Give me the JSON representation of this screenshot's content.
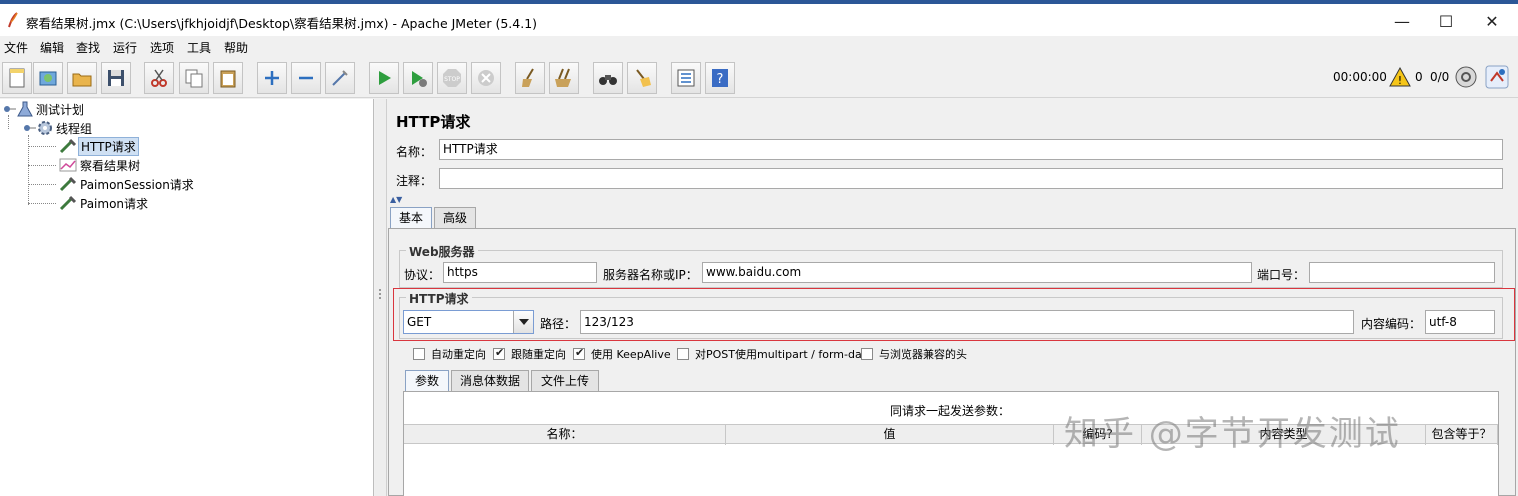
{
  "window": {
    "title": "察看结果树.jmx (C:\\Users\\jfkhjoidjf\\Desktop\\察看结果树.jmx) - Apache JMeter (5.4.1)",
    "minimize": "—",
    "maximize": "☐",
    "close": "✕"
  },
  "menu": [
    "文件",
    "编辑",
    "查找",
    "运行",
    "选项",
    "工具",
    "帮助"
  ],
  "toolbar": {
    "timer": "00:00:00",
    "warning_count": "0",
    "thread_ratio": "0/0"
  },
  "tree": {
    "test_plan": "测试计划",
    "thread_group": "线程组",
    "items": [
      "HTTP请求",
      "察看结果树",
      "PaimonSession请求",
      "Paimon请求"
    ]
  },
  "panel": {
    "title": "HTTP请求",
    "name_label": "名称：",
    "name_value": "HTTP请求",
    "comment_label": "注释：",
    "comment_value": "",
    "tabs": [
      "基本",
      "高级"
    ],
    "web_server": {
      "title": "Web服务器",
      "protocol_label": "协议：",
      "protocol_value": "https",
      "server_label": "服务器名称或IP：",
      "server_value": "www.baidu.com",
      "port_label": "端口号：",
      "port_value": ""
    },
    "http_request": {
      "title": "HTTP请求",
      "method": "GET",
      "path_label": "路径：",
      "path_value": "123/123",
      "encoding_label": "内容编码：",
      "encoding_value": "utf-8"
    },
    "checkboxes": [
      {
        "label": "自动重定向",
        "checked": false
      },
      {
        "label": "跟随重定向",
        "checked": true
      },
      {
        "label": "使用 KeepAlive",
        "checked": true
      },
      {
        "label": "对POST使用multipart / form-data",
        "checked": false
      },
      {
        "label": "与浏览器兼容的头",
        "checked": false
      }
    ],
    "sub_tabs": [
      "参数",
      "消息体数据",
      "文件上传"
    ],
    "params": {
      "caption": "同请求一起发送参数：",
      "columns": [
        "名称：",
        "值",
        "编码?",
        "内容类型",
        "包含等于？"
      ]
    }
  },
  "watermark": "知乎 @字节开发测试"
}
